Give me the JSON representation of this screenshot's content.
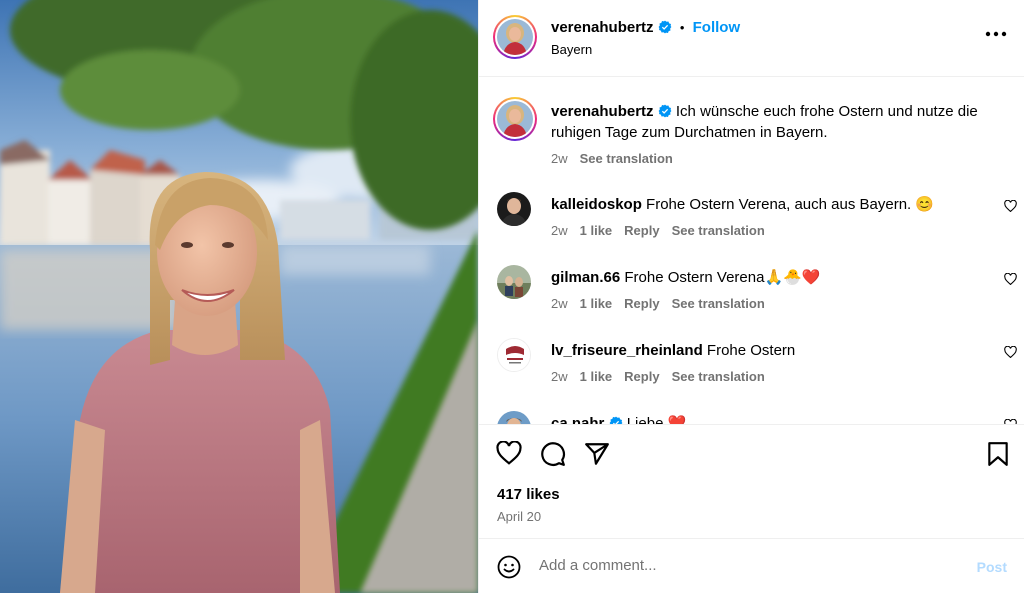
{
  "colors": {
    "link_blue": "#0095f6",
    "muted": "#737373",
    "verified": "#0095f6",
    "heart_red": "#ed4956"
  },
  "header": {
    "username": "verenahubertz",
    "separator": "•",
    "follow_label": "Follow",
    "location": "Bayern",
    "more_icon": "more-horizontal-icon"
  },
  "caption": {
    "username": "verenahubertz",
    "text": "Ich wünsche euch frohe Ostern und nutze die ruhigen Tage zum Durchatmen in Bayern.",
    "age": "2w",
    "see_translation": "See translation"
  },
  "comments": [
    {
      "username": "kalleidoskop",
      "text": "Frohe Ostern Verena, auch aus Bayern. 😊",
      "age": "2w",
      "likes": "1 like",
      "reply": "Reply",
      "see_translation": "See translation"
    },
    {
      "username": "gilman.66",
      "text": "Frohe Ostern Verena🙏🐣❤️",
      "age": "2w",
      "likes": "1 like",
      "reply": "Reply",
      "see_translation": "See translation"
    },
    {
      "username": "lv_friseure_rheinland",
      "text": "Frohe Ostern",
      "age": "2w",
      "likes": "1 like",
      "reply": "Reply",
      "see_translation": "See translation"
    },
    {
      "username": "ca.nahr",
      "text": "Liebe ❤️"
    }
  ],
  "actions": {
    "icons": [
      "heart-icon",
      "comment-icon",
      "share-icon",
      "bookmark-icon"
    ],
    "likes": "417 likes",
    "date": "April 20"
  },
  "add_comment": {
    "placeholder": "Add a comment...",
    "post_label": "Post",
    "emoji_icon": "emoji-icon"
  }
}
